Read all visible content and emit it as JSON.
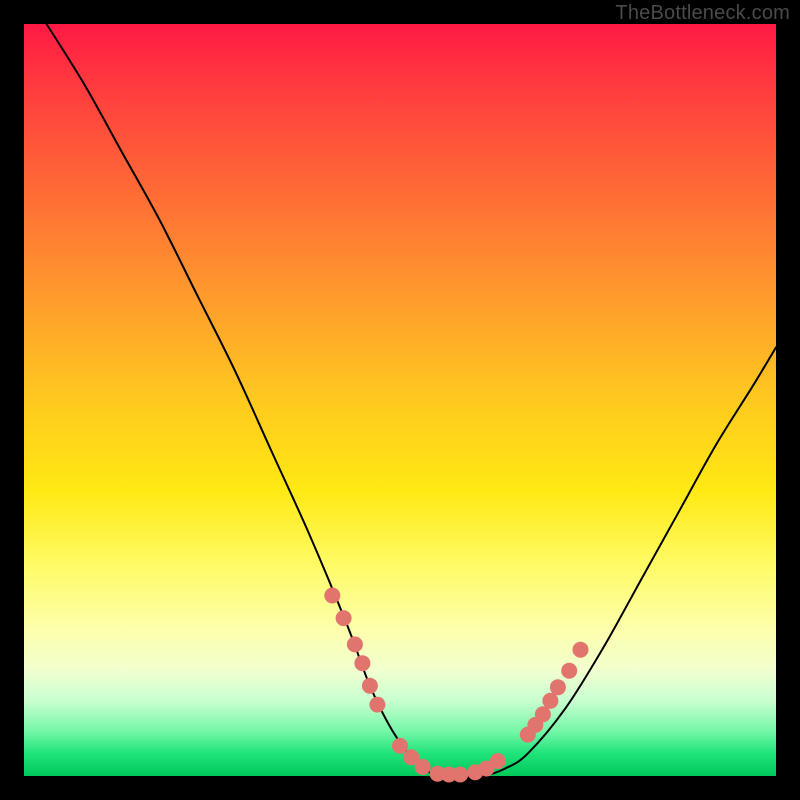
{
  "watermark": "TheBottleneck.com",
  "colors": {
    "background": "#000000",
    "curve": "#000000",
    "markers": "#e2746e",
    "gradient_stops": [
      "#ff1a44",
      "#ff3a3f",
      "#ff6a36",
      "#ff9a2d",
      "#ffc91f",
      "#ffe913",
      "#fffb66",
      "#fdffa8",
      "#f2ffcf",
      "#c8ffd0",
      "#76f7a8",
      "#1fe47a",
      "#00c85a"
    ]
  },
  "chart_data": {
    "type": "line",
    "title": "",
    "xlabel": "",
    "ylabel": "",
    "xlim": [
      0,
      100
    ],
    "ylim": [
      0,
      100
    ],
    "grid": false,
    "legend": false,
    "series": [
      {
        "name": "bottleneck-curve",
        "x": [
          3,
          8,
          13,
          18,
          23,
          28,
          33,
          38,
          43,
          46,
          49,
          52,
          55,
          58,
          61,
          64,
          67,
          72,
          77,
          82,
          87,
          92,
          97,
          100
        ],
        "y": [
          100,
          92,
          83,
          74,
          64,
          54,
          43,
          32,
          20,
          12,
          6,
          2,
          0,
          0,
          0,
          1,
          3,
          9,
          17,
          26,
          35,
          44,
          52,
          57
        ]
      }
    ],
    "markers": {
      "name": "highlight-points",
      "x": [
        41,
        42.5,
        44,
        45,
        46,
        47,
        50,
        51.5,
        53,
        55,
        56.5,
        58,
        60,
        61.5,
        63,
        67,
        68,
        69,
        70,
        71,
        72.5,
        74
      ],
      "y": [
        24,
        21,
        17.5,
        15,
        12,
        9.5,
        4,
        2.5,
        1.2,
        0.3,
        0.2,
        0.2,
        0.5,
        1,
        2,
        5.5,
        6.8,
        8.2,
        10,
        11.8,
        14,
        16.8
      ]
    }
  }
}
